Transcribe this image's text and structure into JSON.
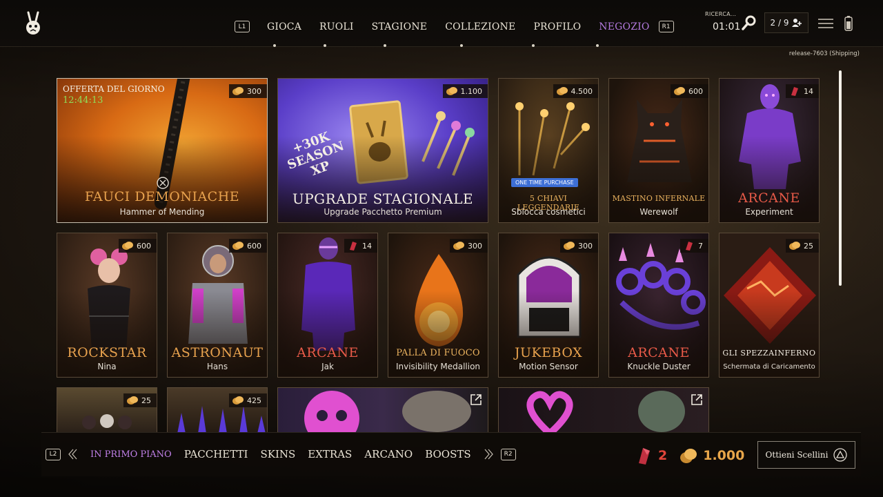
{
  "nav": {
    "left_hint": "L1",
    "right_hint": "R1",
    "items": [
      {
        "label": "GIOCA"
      },
      {
        "label": "RUOLI"
      },
      {
        "label": "STAGIONE"
      },
      {
        "label": "COLLEZIONE"
      },
      {
        "label": "PROFILO"
      },
      {
        "label": "NEGOZIO",
        "active": true
      }
    ]
  },
  "search": {
    "label": "RICERCA...",
    "timer": "01:01"
  },
  "party": {
    "count": "2 / 9"
  },
  "release": "release-7603 (Shipping)",
  "cards": {
    "daily": {
      "label": "OFFERTA DEL GIORNO",
      "timer": "12:44:13",
      "price": "300",
      "title": "FAUCI DEMONIACHE",
      "subtitle": "Hammer of Mending"
    },
    "upgrade": {
      "price": "1.100",
      "xp_line1": "+30K",
      "xp_line2": "SEASON",
      "xp_line3": "XP",
      "title": "UPGRADE STAGIONALE",
      "subtitle": "Upgrade Pacchetto Premium"
    },
    "keys": {
      "price": "4.500",
      "badge": "ONE TIME PURCHASE",
      "title": "5 CHIAVI LEGGENDARIE",
      "subtitle": "Sblocca cosmetici"
    },
    "mastino": {
      "price": "600",
      "title": "MASTINO INFERNALE",
      "subtitle": "Werewolf"
    },
    "experiment": {
      "price": "14",
      "title": "ARCANE",
      "subtitle": "Experiment"
    },
    "rockstar": {
      "price": "600",
      "title": "ROCKSTAR",
      "subtitle": "Nina"
    },
    "astronaut": {
      "price": "600",
      "title": "ASTRONAUT",
      "subtitle": "Hans"
    },
    "jak": {
      "price": "14",
      "title": "ARCANE",
      "subtitle": "Jak"
    },
    "fireball": {
      "price": "300",
      "title": "PALLA DI FUOCO",
      "subtitle": "Invisibility Medallion"
    },
    "jukebox": {
      "price": "300",
      "title": "JUKEBOX",
      "subtitle": "Motion Sensor"
    },
    "knuckle": {
      "price": "7",
      "title": "ARCANE",
      "subtitle": "Knuckle Duster"
    },
    "spezza": {
      "price": "25",
      "title": "GLI SPEZZAINFERNO",
      "subtitle": "Schermata di Caricamento"
    },
    "row3a": {
      "price": "25"
    },
    "row3b": {
      "price": "425"
    }
  },
  "bottom": {
    "left_hint": "L2",
    "right_hint": "R2",
    "categories": [
      {
        "label": "IN PRIMO PIANO",
        "active": true
      },
      {
        "label": "PACCHETTI"
      },
      {
        "label": "SKINS"
      },
      {
        "label": "EXTRAS"
      },
      {
        "label": "ARCANO"
      },
      {
        "label": "BOOSTS"
      }
    ],
    "shards": "2",
    "coins": "1.000",
    "obtain_label": "Ottieni Scellini"
  },
  "colors": {
    "accent_purple": "#b47be0",
    "gold": "#e8a64a",
    "red": "#e0453a"
  },
  "icons": [
    "rabbit-logo-icon",
    "search-icon",
    "party-icon",
    "menu-icon",
    "battery-icon",
    "coin-icon",
    "shard-icon",
    "external-link-icon",
    "triangle-button-icon",
    "chevron-left-icon",
    "chevron-right-icon"
  ]
}
